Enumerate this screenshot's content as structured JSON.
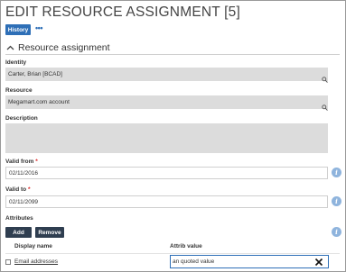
{
  "page": {
    "title": "EDIT RESOURCE ASSIGNMENT [5]",
    "history_label": "History",
    "more_label": "•••"
  },
  "section": {
    "title": "Resource assignment",
    "expanded": true
  },
  "fields": {
    "identity": {
      "label": "Identity",
      "value": "Carter, Brian [BCAD]"
    },
    "resource": {
      "label": "Resource",
      "value": "Megamart.com account"
    },
    "description": {
      "label": "Description",
      "value": ""
    },
    "valid_from": {
      "label": "Valid from",
      "required_mark": "*",
      "value": "02/11/2016"
    },
    "valid_to": {
      "label": "Valid to",
      "required_mark": "*",
      "value": "02/11/2099"
    }
  },
  "attributes": {
    "label": "Attributes",
    "add_label": "Add",
    "remove_label": "Remove",
    "columns": [
      "Display name",
      "Attrib value"
    ],
    "rows": [
      {
        "display_name": "Email addresses",
        "value": "an quoted value",
        "checked": false
      }
    ]
  },
  "icons": {
    "info_glyph": "i",
    "search": "magnifier-icon",
    "clear": "close-icon"
  },
  "colors": {
    "accent": "#2e6fb7",
    "dark_button": "#2f3e50",
    "readonly_bg": "#dcdcdc",
    "info_icon": "#8fb4dd",
    "required": "#dd2222"
  }
}
